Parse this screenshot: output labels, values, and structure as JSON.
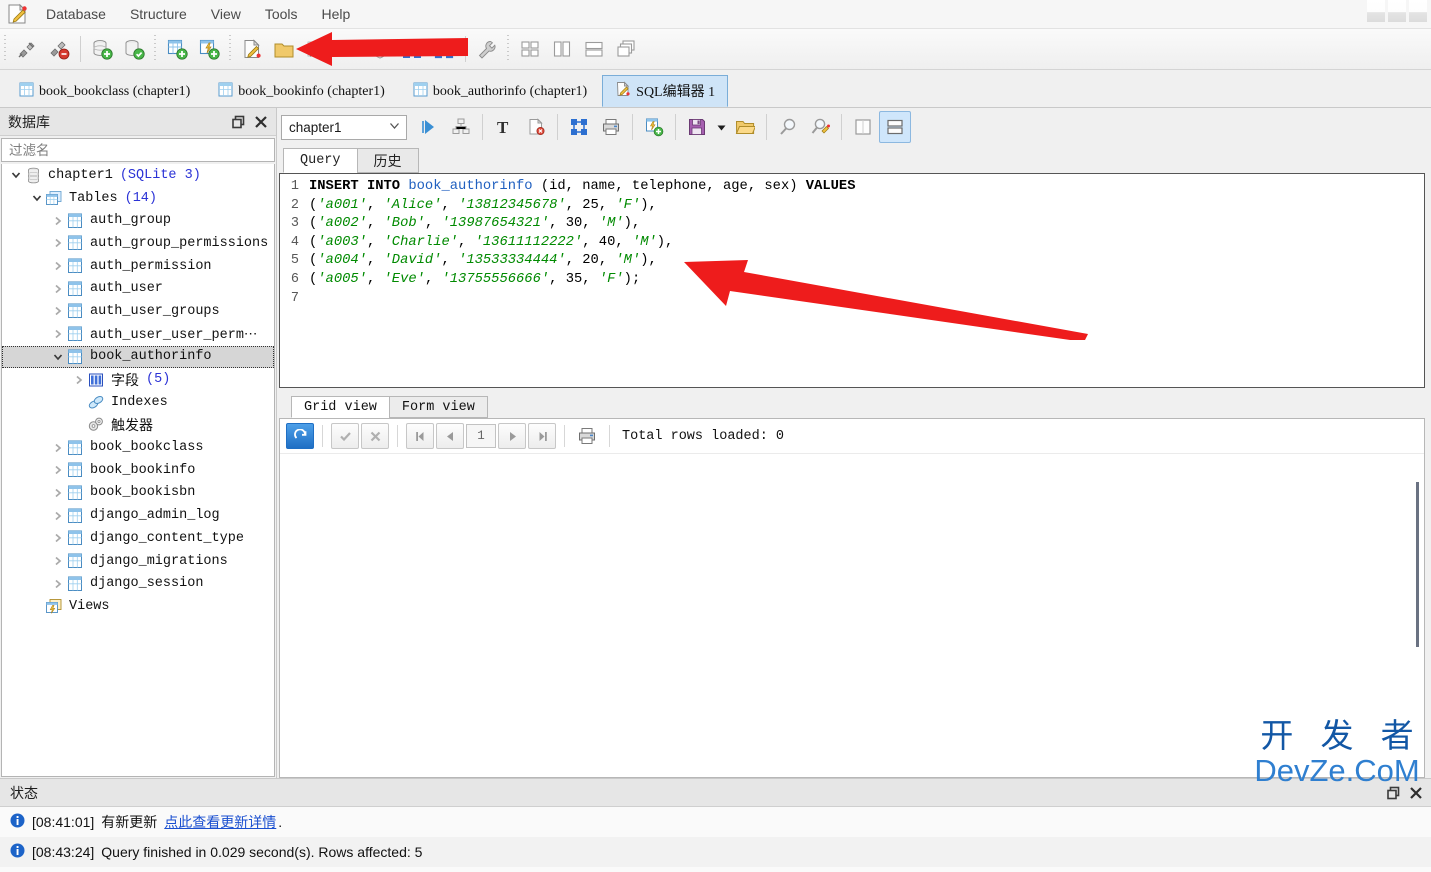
{
  "app": {
    "logo_icon": "sqlite-studio-logo-icon",
    "menu": [
      "Database",
      "Structure",
      "View",
      "Tools",
      "Help"
    ],
    "window_buttons": [
      "minimize",
      "maximize",
      "close"
    ]
  },
  "main_toolbar": {
    "groups": [
      {
        "buttons": [
          {
            "name": "connect-database-button",
            "icon": "plug-connect-icon"
          },
          {
            "name": "disconnect-database-button",
            "icon": "plug-disconnect-icon"
          }
        ]
      },
      {
        "buttons": [
          {
            "name": "add-database-button",
            "icon": "database-add-icon"
          },
          {
            "name": "edit-database-button",
            "icon": "database-edit-icon"
          }
        ]
      },
      {
        "buttons": [
          {
            "name": "create-table-button",
            "icon": "table-add-icon"
          },
          {
            "name": "create-index-button",
            "icon": "index-add-icon"
          }
        ]
      },
      {
        "buttons": [
          {
            "name": "open-sql-editor-button",
            "icon": "sql-editor-icon"
          },
          {
            "name": "open-ddl-history-button",
            "icon": "history-folder-icon"
          },
          {
            "name": "functions-editor-button",
            "icon": "fx-icon"
          },
          {
            "name": "collations-editor-button",
            "icon": "collation-icon"
          },
          {
            "name": "extensions-button",
            "icon": "shield-icon"
          },
          {
            "name": "import-button",
            "icon": "import-arrows-icon"
          },
          {
            "name": "export-button",
            "icon": "export-arrows-icon"
          }
        ]
      },
      {
        "buttons": [
          {
            "name": "configuration-button",
            "icon": "wrench-icon"
          }
        ]
      },
      {
        "buttons": [
          {
            "name": "tile-windows-button",
            "icon": "tile-grid-icon"
          },
          {
            "name": "tile-vertically-button",
            "icon": "tile-vertical-icon"
          },
          {
            "name": "tile-horizontally-button",
            "icon": "tile-horizontal-icon"
          },
          {
            "name": "cascade-windows-button",
            "icon": "cascade-windows-icon"
          }
        ]
      }
    ]
  },
  "document_tabs": [
    {
      "label": "book_bookclass (chapter1)",
      "icon": "table-icon",
      "selected": false
    },
    {
      "label": "book_bookinfo (chapter1)",
      "icon": "table-icon",
      "selected": false
    },
    {
      "label": "book_authorinfo (chapter1)",
      "icon": "table-icon",
      "selected": false
    },
    {
      "label": "SQL编辑器 1",
      "icon": "sql-editor-icon",
      "selected": true
    }
  ],
  "database_panel": {
    "title": "数据库",
    "restore_icon": "restore-window-icon",
    "close_icon": "close-icon",
    "filter_placeholder": "过滤名",
    "filter_value": "",
    "tree": [
      {
        "label": "chapter1",
        "suffix": "(SQLite 3)",
        "icon": "database-icon",
        "expander": "down",
        "indent": 0,
        "selected": false
      },
      {
        "label": "Tables",
        "suffix": "(14)",
        "icon": "tables-folder-icon",
        "expander": "down",
        "indent": 1,
        "selected": false
      },
      {
        "label": "auth_group",
        "suffix": "",
        "icon": "table-icon",
        "expander": "right",
        "indent": 2,
        "selected": false
      },
      {
        "label": "auth_group_permissions",
        "suffix": "",
        "icon": "table-icon",
        "expander": "right",
        "indent": 2,
        "selected": false
      },
      {
        "label": "auth_permission",
        "suffix": "",
        "icon": "table-icon",
        "expander": "right",
        "indent": 2,
        "selected": false
      },
      {
        "label": "auth_user",
        "suffix": "",
        "icon": "table-icon",
        "expander": "right",
        "indent": 2,
        "selected": false
      },
      {
        "label": "auth_user_groups",
        "suffix": "",
        "icon": "table-icon",
        "expander": "right",
        "indent": 2,
        "selected": false
      },
      {
        "label": "auth_user_user_perm⋯",
        "suffix": "",
        "icon": "table-icon",
        "expander": "right",
        "indent": 2,
        "selected": false
      },
      {
        "label": "book_authorinfo",
        "suffix": "",
        "icon": "table-icon",
        "expander": "down",
        "indent": 2,
        "selected": true
      },
      {
        "label": "字段",
        "suffix": "(5)",
        "icon": "columns-icon",
        "expander": "right",
        "indent": 3,
        "selected": false,
        "cjk": true
      },
      {
        "label": "Indexes",
        "suffix": "",
        "icon": "index-icon",
        "expander": "none",
        "indent": 3,
        "selected": false
      },
      {
        "label": "触发器",
        "suffix": "",
        "icon": "trigger-icon",
        "expander": "none",
        "indent": 3,
        "selected": false,
        "cjk": true
      },
      {
        "label": "book_bookclass",
        "suffix": "",
        "icon": "table-icon",
        "expander": "right",
        "indent": 2,
        "selected": false
      },
      {
        "label": "book_bookinfo",
        "suffix": "",
        "icon": "table-icon",
        "expander": "right",
        "indent": 2,
        "selected": false
      },
      {
        "label": "book_bookisbn",
        "suffix": "",
        "icon": "table-icon",
        "expander": "right",
        "indent": 2,
        "selected": false
      },
      {
        "label": "django_admin_log",
        "suffix": "",
        "icon": "table-icon",
        "expander": "right",
        "indent": 2,
        "selected": false
      },
      {
        "label": "django_content_type",
        "suffix": "",
        "icon": "table-icon",
        "expander": "right",
        "indent": 2,
        "selected": false
      },
      {
        "label": "django_migrations",
        "suffix": "",
        "icon": "table-icon",
        "expander": "right",
        "indent": 2,
        "selected": false
      },
      {
        "label": "django_session",
        "suffix": "",
        "icon": "table-icon",
        "expander": "right",
        "indent": 2,
        "selected": false
      },
      {
        "label": "Views",
        "suffix": "",
        "icon": "views-folder-icon",
        "expander": "none",
        "indent": 1,
        "selected": false
      }
    ]
  },
  "query_toolbar": {
    "database_selected": "chapter1",
    "dropdown_icon": "chevron-down-icon",
    "buttons": [
      {
        "name": "execute-query-button",
        "icon": "play-icon"
      },
      {
        "name": "explain-query-button",
        "icon": "query-plan-icon"
      },
      {
        "name": "format-sql-button",
        "icon": "text-format-icon"
      },
      {
        "name": "clear-query-button",
        "icon": "clear-document-icon"
      },
      {
        "name": "export-results-button",
        "icon": "export-arrows-icon"
      },
      {
        "name": "print-results-button",
        "icon": "printer-icon"
      },
      {
        "name": "create-view-from-query-button",
        "icon": "view-add-icon"
      },
      {
        "name": "save-sql-button",
        "icon": "floppy-save-icon"
      },
      {
        "name": "save-sql-dropdown",
        "icon": "caret-down-icon"
      },
      {
        "name": "open-sql-file-button",
        "icon": "open-folder-icon"
      },
      {
        "name": "find-button",
        "icon": "magnifier-icon"
      },
      {
        "name": "find-replace-button",
        "icon": "magnifier-edit-icon"
      },
      {
        "name": "toggle-results-panel-button",
        "icon": "panel-blank-icon"
      },
      {
        "name": "split-view-button",
        "icon": "panel-split-icon"
      }
    ]
  },
  "editor_tabs": [
    {
      "label": "Query",
      "selected": true
    },
    {
      "label": "历史",
      "selected": false,
      "cjk": true
    }
  ],
  "sql": {
    "lines": [
      {
        "n": "1",
        "segments": [
          {
            "t": "INSERT INTO ",
            "c": "kw"
          },
          {
            "t": "book_authorinfo",
            "c": "tblname"
          },
          {
            "t": " (id, name, telephone, age, sex) ",
            "c": ""
          },
          {
            "t": "VALUES",
            "c": "kw"
          }
        ]
      },
      {
        "n": "2",
        "segments": [
          {
            "t": "(",
            "c": ""
          },
          {
            "t": "'a001'",
            "c": "str"
          },
          {
            "t": ", ",
            "c": ""
          },
          {
            "t": "'Alice'",
            "c": "str"
          },
          {
            "t": ", ",
            "c": ""
          },
          {
            "t": "'13812345678'",
            "c": "str"
          },
          {
            "t": ", 25, ",
            "c": ""
          },
          {
            "t": "'F'",
            "c": "str"
          },
          {
            "t": "),",
            "c": ""
          }
        ]
      },
      {
        "n": "3",
        "segments": [
          {
            "t": "(",
            "c": ""
          },
          {
            "t": "'a002'",
            "c": "str"
          },
          {
            "t": ", ",
            "c": ""
          },
          {
            "t": "'Bob'",
            "c": "str"
          },
          {
            "t": ", ",
            "c": ""
          },
          {
            "t": "'13987654321'",
            "c": "str"
          },
          {
            "t": ", 30, ",
            "c": ""
          },
          {
            "t": "'M'",
            "c": "str"
          },
          {
            "t": "),",
            "c": ""
          }
        ]
      },
      {
        "n": "4",
        "segments": [
          {
            "t": "(",
            "c": ""
          },
          {
            "t": "'a003'",
            "c": "str"
          },
          {
            "t": ", ",
            "c": ""
          },
          {
            "t": "'Charlie'",
            "c": "str"
          },
          {
            "t": ", ",
            "c": ""
          },
          {
            "t": "'13611112222'",
            "c": "str"
          },
          {
            "t": ", 40, ",
            "c": ""
          },
          {
            "t": "'M'",
            "c": "str"
          },
          {
            "t": "),",
            "c": ""
          }
        ]
      },
      {
        "n": "5",
        "segments": [
          {
            "t": "(",
            "c": ""
          },
          {
            "t": "'a004'",
            "c": "str"
          },
          {
            "t": ", ",
            "c": ""
          },
          {
            "t": "'David'",
            "c": "str"
          },
          {
            "t": ", ",
            "c": ""
          },
          {
            "t": "'13533334444'",
            "c": "str"
          },
          {
            "t": ", 20, ",
            "c": ""
          },
          {
            "t": "'M'",
            "c": "str"
          },
          {
            "t": "),",
            "c": ""
          }
        ]
      },
      {
        "n": "6",
        "segments": [
          {
            "t": "(",
            "c": ""
          },
          {
            "t": "'a005'",
            "c": "str"
          },
          {
            "t": ", ",
            "c": ""
          },
          {
            "t": "'Eve'",
            "c": "str"
          },
          {
            "t": ", ",
            "c": ""
          },
          {
            "t": "'13755556666'",
            "c": "str"
          },
          {
            "t": ", 35, ",
            "c": ""
          },
          {
            "t": "'F'",
            "c": "str"
          },
          {
            "t": ");",
            "c": ""
          }
        ]
      },
      {
        "n": "7",
        "segments": []
      }
    ]
  },
  "results": {
    "tabs": [
      {
        "label": "Grid view",
        "selected": true
      },
      {
        "label": "Form view",
        "selected": false
      }
    ],
    "toolbar": [
      {
        "name": "refresh-grid-button",
        "icon": "refresh-icon"
      },
      {
        "name": "commit-button",
        "icon": "check-icon"
      },
      {
        "name": "rollback-button",
        "icon": "cancel-icon"
      },
      {
        "name": "first-page-button",
        "icon": "first-page-icon"
      },
      {
        "name": "previous-page-button",
        "icon": "previous-page-icon"
      },
      {
        "name": "next-page-button",
        "icon": "next-page-icon"
      },
      {
        "name": "last-page-button",
        "icon": "last-page-icon"
      },
      {
        "name": "print-grid-button",
        "icon": "printer-icon"
      }
    ],
    "page_number": "1",
    "total_rows_label": "Total rows loaded: 0"
  },
  "status_panel": {
    "title": "状态",
    "restore_icon": "restore-window-icon",
    "close_icon": "close-icon",
    "entries": [
      {
        "icon": "info-icon",
        "time": "[08:41:01]",
        "text": "有新更新",
        "link": "点此查看更新详情",
        "tail": "."
      },
      {
        "icon": "info-icon",
        "time": "[08:43:24]",
        "text": "Query finished in 0.029 second(s). Rows affected: 5",
        "link": "",
        "tail": ""
      }
    ]
  },
  "annotations": {
    "arrow_color": "#ee1c1c",
    "arrows": [
      "toolbar-pointer-arrow",
      "sql-editor-pointer-arrow"
    ]
  },
  "watermark": {
    "line1": "开 发 者",
    "line2": "DevZe.CoM",
    "color": "#1257a5"
  }
}
